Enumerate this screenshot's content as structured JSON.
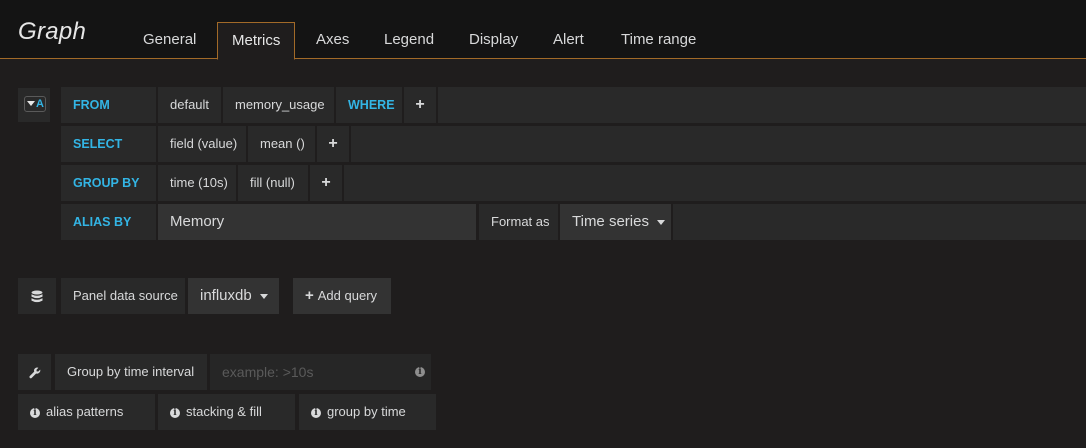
{
  "panel": {
    "title": "Graph"
  },
  "tabs": [
    {
      "label": "General"
    },
    {
      "label": "Metrics"
    },
    {
      "label": "Axes"
    },
    {
      "label": "Legend"
    },
    {
      "label": "Display"
    },
    {
      "label": "Alert"
    },
    {
      "label": "Time range"
    }
  ],
  "query": {
    "ref_id": "A",
    "from": {
      "keyword": "FROM",
      "policy": "default",
      "measurement": "memory_usage",
      "where_keyword": "WHERE",
      "add": "+"
    },
    "select": {
      "keyword": "SELECT",
      "field": "field (value)",
      "func": "mean ()",
      "add": "+"
    },
    "group_by": {
      "keyword": "GROUP BY",
      "time": "time (10s)",
      "fill": "fill (null)",
      "add": "+"
    },
    "alias_by": {
      "keyword": "ALIAS BY",
      "value": "Memory",
      "format_label": "Format as",
      "format_value": "Time series"
    }
  },
  "datasource": {
    "label": "Panel data source",
    "value": "influxdb",
    "add_query": "Add query",
    "add_plus": "+"
  },
  "options": {
    "interval_label": "Group by time interval",
    "interval_placeholder": "example: >10s",
    "help": [
      "alias patterns",
      "stacking & fill",
      "group by time"
    ]
  },
  "icons": {
    "database": "database-icon",
    "wrench": "wrench-icon",
    "info": "info-icon",
    "caret": "caret-down-icon"
  },
  "colors": {
    "accent": "#a26a28",
    "keyword": "#33b5e5",
    "background": "#1f1d1d",
    "cell": "#292929"
  }
}
